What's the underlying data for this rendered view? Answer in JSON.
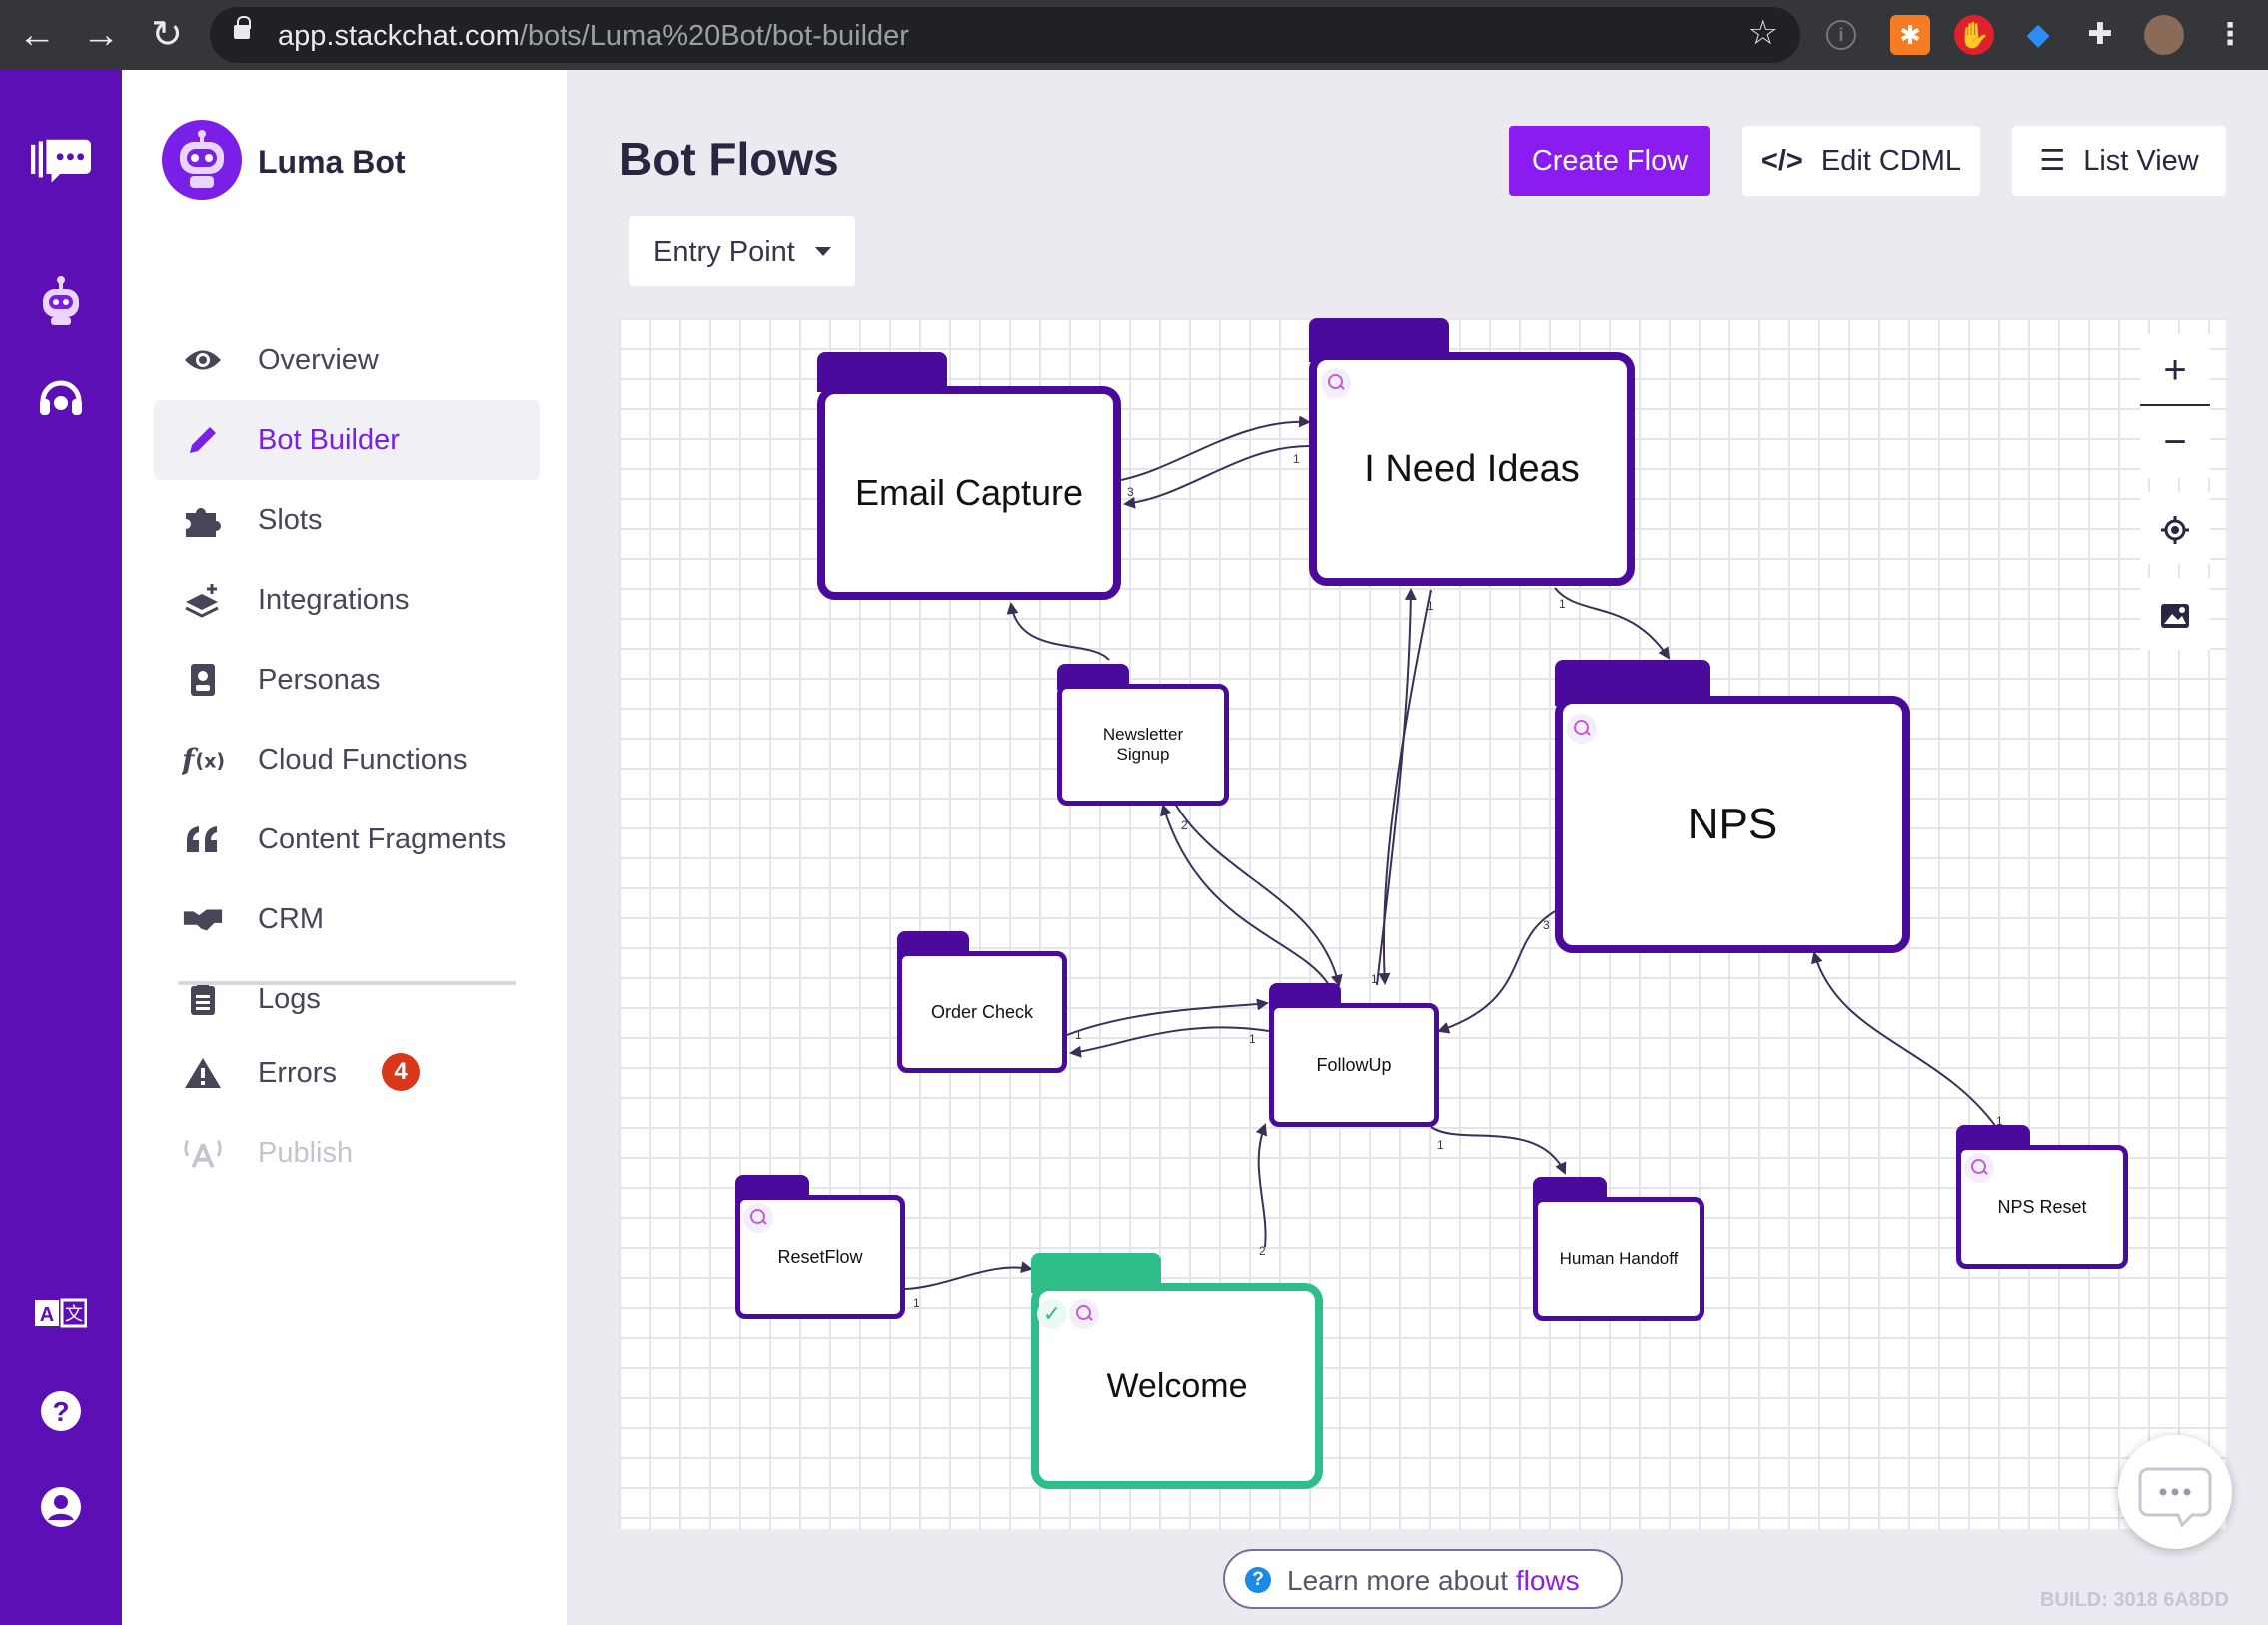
{
  "browser": {
    "url_host": "app.stackchat.com",
    "url_path": "/bots/Luma%20Bot/bot-builder"
  },
  "sidebar": {
    "bot_name": "Luma Bot",
    "items": [
      {
        "label": "Overview",
        "icon": "eye-icon"
      },
      {
        "label": "Bot Builder",
        "icon": "pencil-icon",
        "active": true
      },
      {
        "label": "Slots",
        "icon": "puzzle-icon"
      },
      {
        "label": "Integrations",
        "icon": "layers-plus-icon"
      },
      {
        "label": "Personas",
        "icon": "id-badge-icon"
      },
      {
        "label": "Cloud Functions",
        "icon": "function-icon"
      },
      {
        "label": "Content Fragments",
        "icon": "quote-icon"
      },
      {
        "label": "CRM",
        "icon": "handshake-icon"
      },
      {
        "label": "Logs",
        "icon": "clipboard-icon"
      },
      {
        "label": "Errors",
        "icon": "warning-icon",
        "badge": "4"
      },
      {
        "label": "Publish",
        "icon": "broadcast-icon",
        "disabled": true
      }
    ]
  },
  "main": {
    "title": "Bot Flows",
    "create_flow": "Create Flow",
    "edit_cdml": "Edit CDML",
    "list_view": "List View",
    "entry_point": "Entry Point"
  },
  "flows": {
    "email_capture": "Email Capture",
    "i_need_ideas": "I Need Ideas",
    "newsletter_signup": "Newsletter Signup",
    "nps": "NPS",
    "order_check": "Order Check",
    "followup": "FollowUp",
    "resetflow": "ResetFlow",
    "welcome": "Welcome",
    "human_handoff": "Human Handoff",
    "nps_reset": "NPS Reset"
  },
  "edge_labels": [
    "3",
    "1",
    "1",
    "1",
    "1",
    "1",
    "3",
    "2",
    "1",
    "1",
    "1",
    "2",
    "1"
  ],
  "footer": {
    "learn_prefix": "Learn more about ",
    "learn_link": "flows",
    "build": "BUILD: 3018 6A8DD"
  },
  "colors": {
    "brand_purple": "#5b0fb5",
    "accent": "#8b1cf0",
    "node_border": "#4a0a9c",
    "entry_green": "#2fbe89",
    "error_red": "#d9371a"
  }
}
